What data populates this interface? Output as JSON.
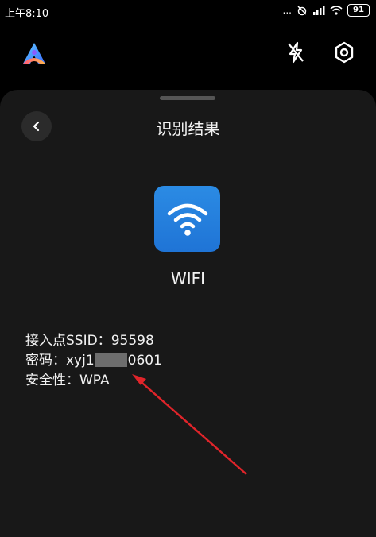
{
  "status_bar": {
    "time": "上午8:10",
    "indicators": "... ",
    "battery": "91"
  },
  "header": {
    "logo_icon": "app-logo-icon",
    "flash_icon": "flash-off-icon",
    "settings_icon": "settings-icon"
  },
  "sheet": {
    "title": "识别结果",
    "back_icon": "chevron-left-icon",
    "wifi_icon": "wifi-icon",
    "wifi_label": "WIFI"
  },
  "info": {
    "ssid_label": "接入点SSID：",
    "ssid_value": "95598",
    "password_label": "密码：",
    "password_prefix": "xyj1",
    "password_suffix": "0601",
    "security_label": "安全性：",
    "security_value": "WPA"
  },
  "annotation": {
    "arrow_color": "#e0242a"
  },
  "colors": {
    "accent_blue": "#1f74d6",
    "sheet_bg": "#181818"
  }
}
